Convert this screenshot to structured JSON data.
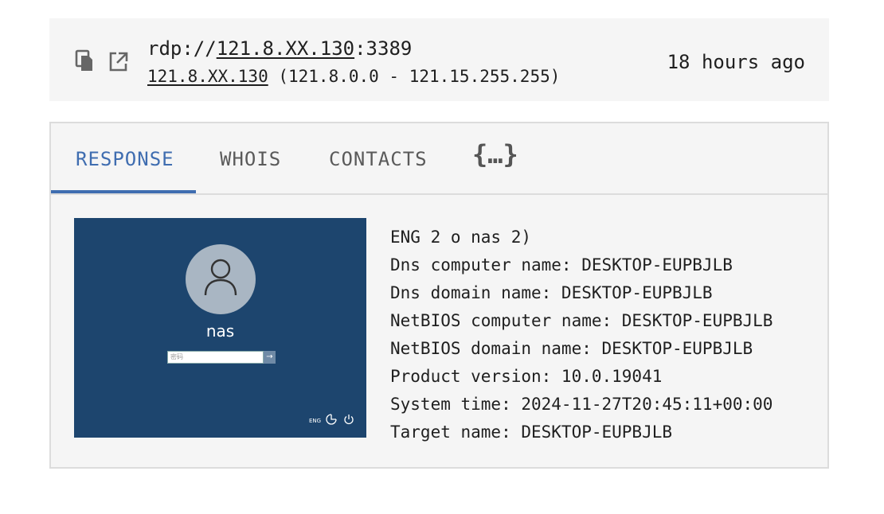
{
  "header": {
    "url_prefix": "rdp://",
    "url_host": "121.8.XX.130",
    "url_port": ":3389",
    "ip": "121.8.XX.130",
    "ip_range": " (121.8.0.0 - 121.15.255.255)",
    "time_ago": "18 hours ago",
    "icons": [
      "copy-icon",
      "open-external-icon"
    ]
  },
  "tabs": [
    {
      "label": "RESPONSE",
      "active": true
    },
    {
      "label": "WHOIS",
      "active": false
    },
    {
      "label": "CONTACTS",
      "active": false
    },
    {
      "label": "{…}",
      "active": false
    }
  ],
  "screenshot": {
    "username": "nas",
    "password_placeholder": "密码",
    "language": "ENG",
    "arrow": "→"
  },
  "response_lines": [
    "ENG 2 o nas 2)",
    "Dns computer name: DESKTOP-EUPBJLB",
    "Dns domain name: DESKTOP-EUPBJLB",
    "NetBIOS computer name: DESKTOP-EUPBJLB",
    "NetBIOS domain name: DESKTOP-EUPBJLB",
    "Product version: 10.0.19041",
    "System time: 2024-11-27T20:45:11+00:00",
    "Target name: DESKTOP-EUPBJLB"
  ],
  "colors": {
    "accent": "#3f6db0",
    "panel_bg": "#f5f5f5",
    "screenshot_bg": "#1d456e"
  }
}
